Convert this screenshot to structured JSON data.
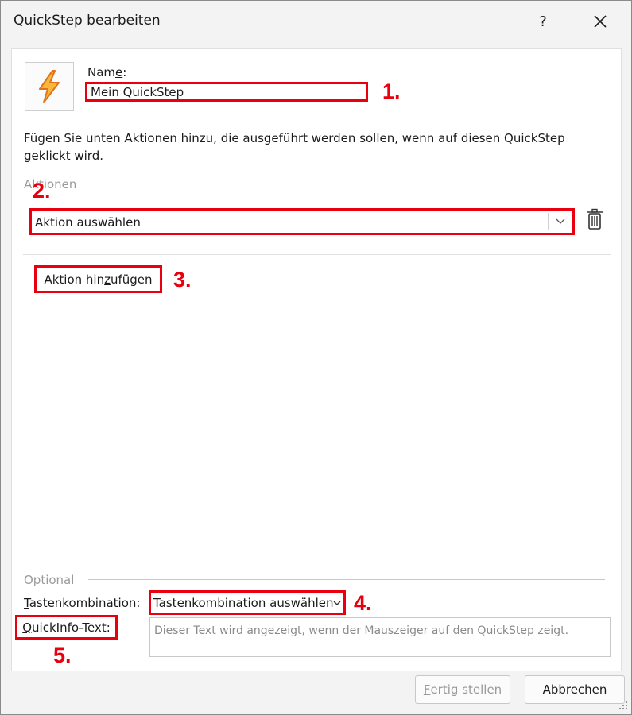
{
  "window": {
    "title": "QuickStep bearbeiten",
    "help_label": "?"
  },
  "name_field": {
    "label": "Name:",
    "label_pre": "Nam",
    "label_ul": "e",
    "label_post": ":",
    "value": "Mein QuickStep",
    "icon": "lightning-bolt-icon"
  },
  "description": "Fügen Sie unten Aktionen hinzu, die ausgeführt werden sollen, wenn auf diesen QuickStep geklickt wird.",
  "actions_section": {
    "label": "Aktionen",
    "select_value": "Aktion auswählen",
    "add_button_pre": "Aktion hin",
    "add_button_ul": "z",
    "add_button_post": "ufügen"
  },
  "optional_section": {
    "label": "Optional",
    "shortcut_label_ul": "T",
    "shortcut_label_post": "astenkombination:",
    "shortcut_value": "Tastenkombination auswählen",
    "quickinfo_label_ul": "Q",
    "quickinfo_label_post": "uickInfo-Text:",
    "quickinfo_placeholder": "Dieser Text wird angezeigt, wenn der Mauszeiger auf den QuickStep zeigt."
  },
  "annotations": [
    "1.",
    "2.",
    "3.",
    "4.",
    "5."
  ],
  "footer": {
    "finish_ul": "F",
    "finish_post": "ertig stellen",
    "cancel": "Abbrechen"
  },
  "colors": {
    "annotation_red": "#e8000f",
    "bolt_fill": "#f6b73c",
    "bolt_stroke": "#e0731b"
  }
}
